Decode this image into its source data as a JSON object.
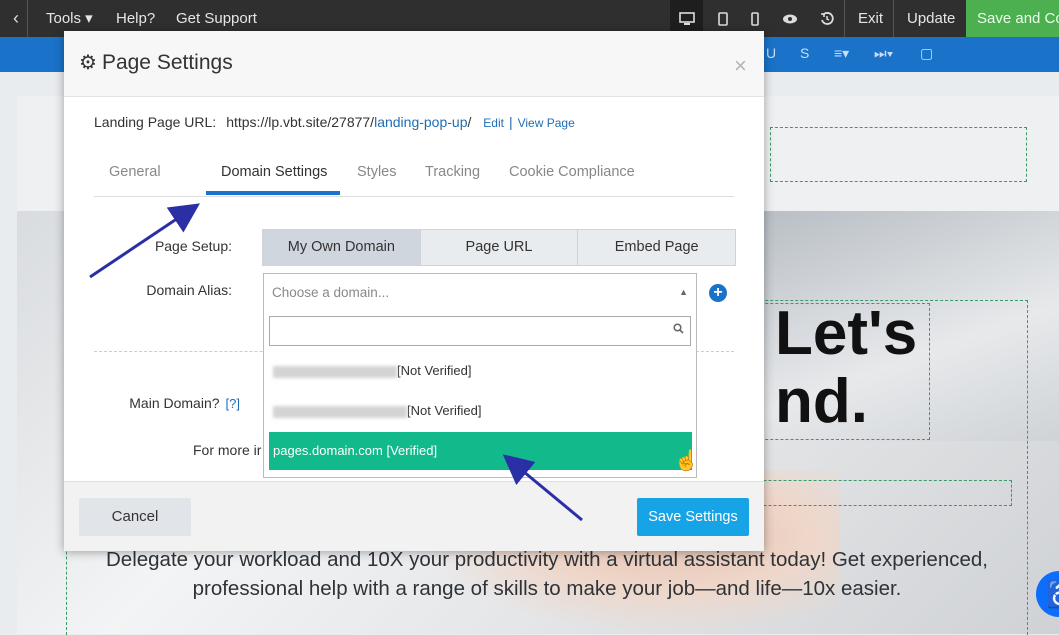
{
  "topbar": {
    "back_icon": "chevron-left-icon",
    "tools": "Tools ▾",
    "help": "Help?",
    "support": "Get Support",
    "exit": "Exit",
    "update": "Update",
    "save_close": "Save and Co"
  },
  "hero": {
    "title_line1": "Let's",
    "title_line2": "nd.",
    "description": "Delegate your workload and 10X your productivity with a virtual assistant today! Get experienced, professional help with a range of skills to make your job—and life—10x easier."
  },
  "modal": {
    "title": "Page Settings",
    "close": "×",
    "url_label": "Landing Page URL:",
    "url_base": "https://lp.vbt.site/27877/",
    "url_slug": "landing-pop-up",
    "url_trailing": "/",
    "edit": "Edit",
    "view_page": "View Page",
    "tabs": [
      "General",
      "Domain Settings",
      "Styles",
      "Tracking",
      "Cookie Compliance"
    ],
    "page_setup_label": "Page Setup:",
    "page_setup_options": [
      "My Own Domain",
      "Page URL",
      "Embed Page"
    ],
    "domain_alias_label": "Domain Alias:",
    "domain_placeholder": "Choose a domain...",
    "main_domain_label": "Main Domain?",
    "main_domain_help": "[?]",
    "more_info": "For more ir",
    "cancel": "Cancel",
    "save": "Save Settings"
  },
  "dropdown": {
    "options": [
      {
        "status": "[Not Verified]"
      },
      {
        "status": "[Not Verified]"
      },
      {
        "domain": "pages.domain.com",
        "status": "[Verified]"
      }
    ]
  },
  "colors": {
    "accent": "#1a73c9",
    "verified": "#12b98a",
    "save": "#16a4e6"
  }
}
